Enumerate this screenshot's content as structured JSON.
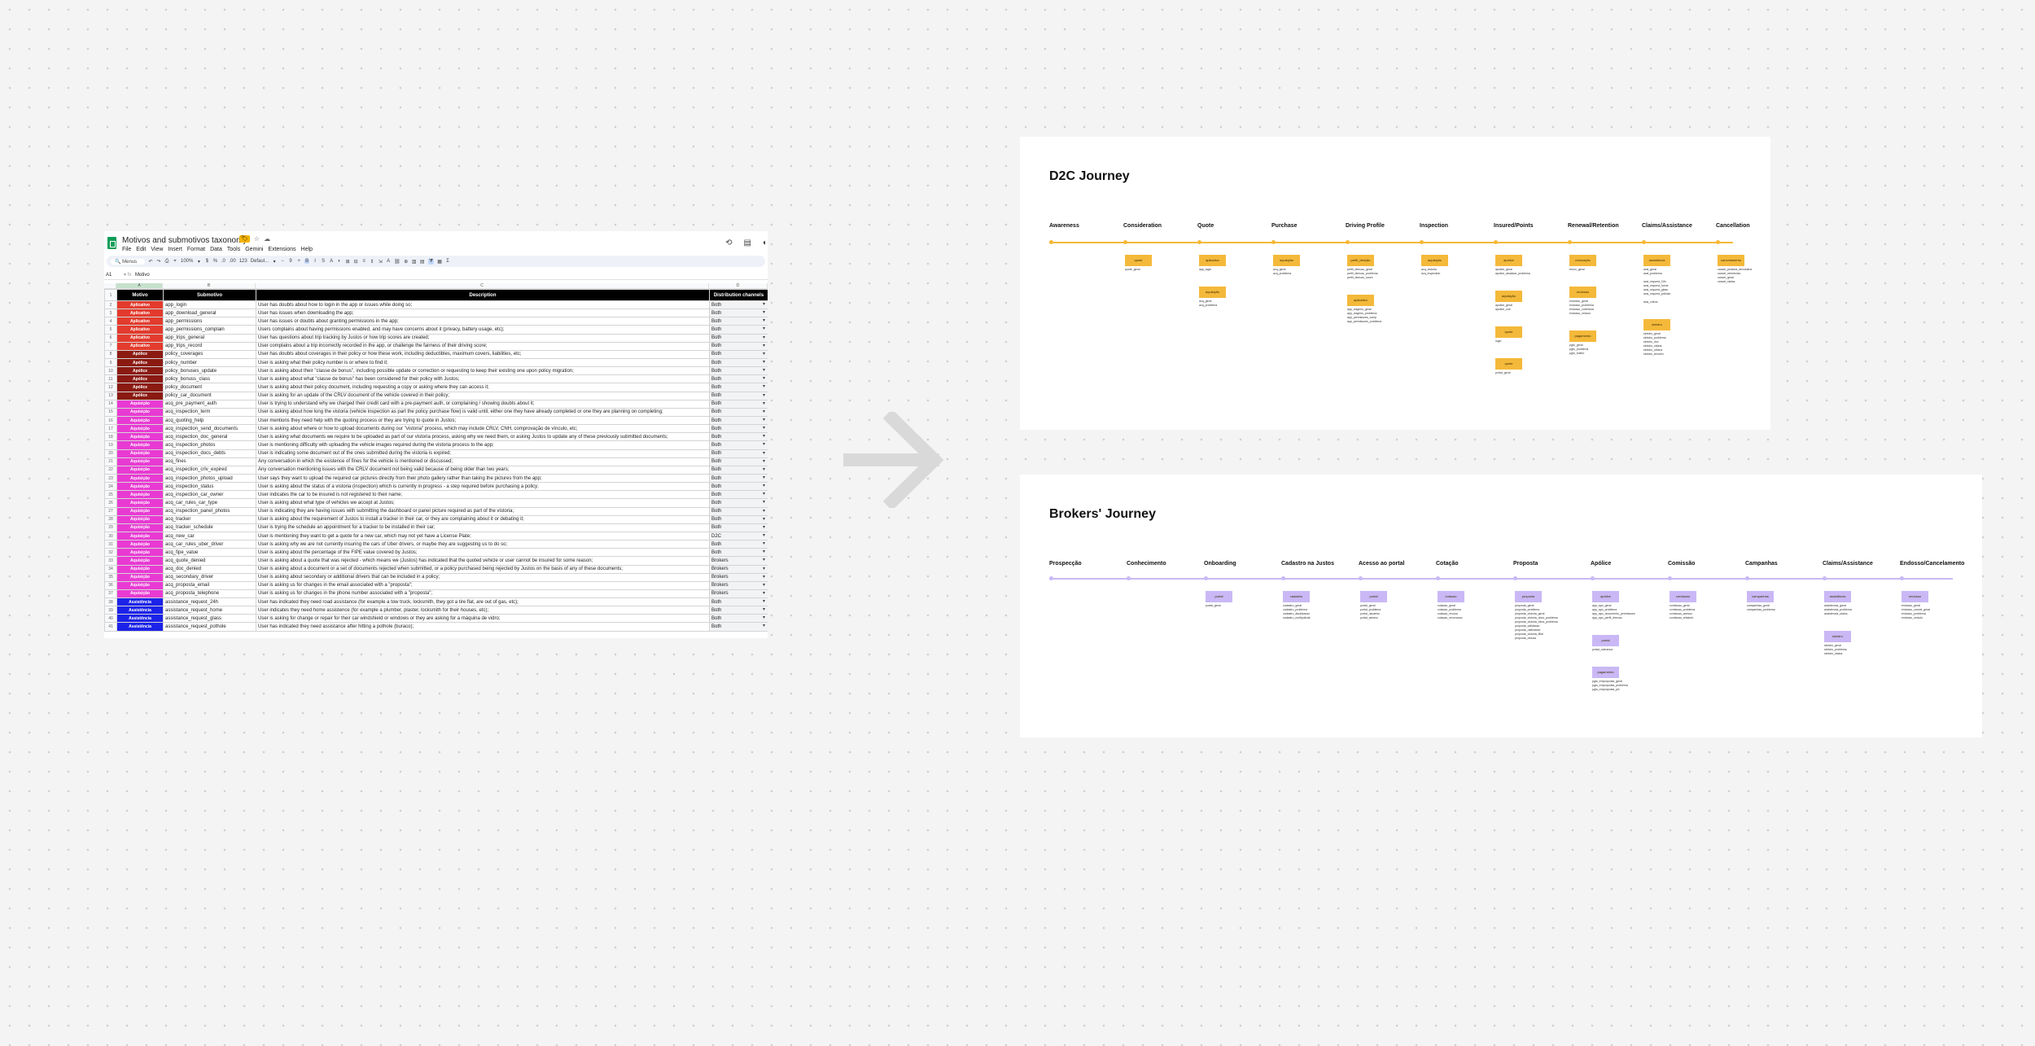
{
  "sheet": {
    "title": "Motivos and submotivos taxonomy",
    "menu": [
      "File",
      "Edit",
      "View",
      "Insert",
      "Format",
      "Data",
      "Tools",
      "Gemini",
      "Extensions",
      "Help"
    ],
    "toolbar": {
      "search": "Menus",
      "items": [
        "↶",
        "↷",
        "⎙",
        "⌖",
        "100%",
        "▾",
        "$",
        "%",
        ".0",
        ".00",
        "123",
        "Defaul...",
        "▾",
        "−",
        "9",
        "+",
        "B",
        "I",
        "S",
        "A",
        "◐",
        "⊞",
        "⊟",
        "≡",
        "⇕",
        "⇲",
        "A",
        "⛓",
        "⊕",
        "▥",
        "▤",
        "⧩",
        "▦",
        "Σ"
      ]
    },
    "cell_ref": "A1",
    "formula": "Motivo",
    "col_letters": [
      "A",
      "B",
      "C",
      "D"
    ],
    "headers": [
      "Motivo",
      "Submotivo",
      "Description",
      "Distribution channels"
    ],
    "rows": [
      [
        "2",
        "Aplicativo",
        "app_login",
        "User has doubts about how to login in the app or issues while doing so;",
        "Both"
      ],
      [
        "3",
        "Aplicativo",
        "app_download_general",
        "User has issues when downloading the app;",
        "Both"
      ],
      [
        "4",
        "Aplicativo",
        "app_permissions",
        "User has issues or doubts about granting permissions in the app;",
        "Both"
      ],
      [
        "5",
        "Aplicativo",
        "app_permissions_complain",
        "Users complains about having permissions enabled, and may have concerns about it (privacy, battery usage, etc);",
        "Both"
      ],
      [
        "6",
        "Aplicativo",
        "app_trips_general",
        "User has questions about trip tracking by Justos or how trip scores are created;",
        "Both"
      ],
      [
        "7",
        "Aplicativo",
        "app_trips_record",
        "User complains about a trip incorrectly recorded in the app, or challenge the fairness of their driving score;",
        "Both"
      ],
      [
        "8",
        "Apólice",
        "policy_coverages",
        "User has doubts about coverages in their policy or how these work, including deductibles, maximum covers, liabilities, etc;",
        "Both"
      ],
      [
        "9",
        "Apólice",
        "policy_number",
        "User is asking what their policy number is or where to find it;",
        "Both"
      ],
      [
        "10",
        "Apólice",
        "policy_bonuses_update",
        "User is asking about their \"classe de bonus\", including possible update or correction or requesting to keep their existing one upon policy migration;",
        "Both"
      ],
      [
        "11",
        "Apólice",
        "policy_bonuss_class",
        "User is asking about what \"classe de bonus\" has been considered for their policy with Justos;",
        "Both"
      ],
      [
        "12",
        "Apólice",
        "policy_document",
        "User is asking about their policy document, including requesting a copy or asking where they can access it;",
        "Both"
      ],
      [
        "13",
        "Apólice",
        "policy_car_document",
        "User is asking for an update of the CRLV document of the vehicle covered in their policy;",
        "Both"
      ],
      [
        "14",
        "Aquisição",
        "acq_pre_payment_auth",
        "User is trying to understand why we charged their credit card with a pre-payment auth, or complaining / showing doubts about it;",
        "Both"
      ],
      [
        "15",
        "Aquisição",
        "acq_inspection_term",
        "User is asking about how long the vistoria (vehicle inspection as part the policy purchase flow) is valid until, either one they have already completed or one they are planning on completing;",
        "Both"
      ],
      [
        "16",
        "Aquisição",
        "acq_quoting_help",
        "User mentions they need help with the quoting process or they are trying to quote in Justos;",
        "Both"
      ],
      [
        "17",
        "Aquisição",
        "acq_inspection_send_documents",
        "User is asking about where or how to upload documents during our \"vistoria\" process, which may include CRLV, CNH, comprovação de vínculo, etc;",
        "Both"
      ],
      [
        "18",
        "Aquisição",
        "acq_inspection_doc_general",
        "User is asking what documents we require to be uploaded as part of our vistoria process, asking why we need them, or asking Justos to update any of these previously submitted documents;",
        "Both"
      ],
      [
        "19",
        "Aquisição",
        "acq_inspection_photos",
        "User is mentioning difficulty with uploading the vehicle images required during the vistoria process to the app;",
        "Both"
      ],
      [
        "20",
        "Aquisição",
        "acq_inspection_docs_debts",
        "User is indicating some document out of the ones submitted during the vistoria is expired;",
        "Both"
      ],
      [
        "21",
        "Aquisição",
        "acq_fines",
        "Any conversation in which the existence of fines for the vehicle is mentioned or discussed;",
        "Both"
      ],
      [
        "22",
        "Aquisição",
        "acq_inspection_crlv_expired",
        "Any conversation mentioning issues with the CRLV document not being valid because of being older than two years;",
        "Both"
      ],
      [
        "23",
        "Aquisição",
        "acq_inspection_photos_upload",
        "User says they want to upload the required car pictures directly from their photo gallery rather than taking the pictures from the app;",
        "Both"
      ],
      [
        "24",
        "Aquisição",
        "acq_inspection_status",
        "User is asking about the status of a vistoria (inspection) which is currently in progress - a step required before purchasing a policy;",
        "Both"
      ],
      [
        "25",
        "Aquisição",
        "acq_inspection_car_owner",
        "User indicates the car to be insured is not registered to their name;",
        "Both"
      ],
      [
        "26",
        "Aquisição",
        "acq_car_rules_car_type",
        "User is asking about what type of vehicles we accept at Justos;",
        "Both"
      ],
      [
        "27",
        "Aquisição",
        "acq_inspection_panel_photos",
        "User is indicating they are having issues with submitting the dashboard or panel picture required as part of the vistoria;",
        "Both"
      ],
      [
        "28",
        "Aquisição",
        "acq_tracker",
        "User is asking about the requirement of Justos to install a tracker in their car, or they are complaining about it or debating it;",
        "Both"
      ],
      [
        "29",
        "Aquisição",
        "acq_tracker_schedule",
        "User is trying the schedule an appointment for a tracker to be installed in their car;",
        "Both"
      ],
      [
        "30",
        "Aquisição",
        "acq_new_car",
        "User is mentioning they want to get a quote for a new car, which may not yet have a License Plate;",
        "D2C"
      ],
      [
        "31",
        "Aquisição",
        "acq_car_rules_uber_driver",
        "User is asking why we are not currently insuring the cars of Uber drivers, or maybe they are suggesting us to do so;",
        "Both"
      ],
      [
        "32",
        "Aquisição",
        "acq_fipe_value",
        "User is asking about the percentage of the FIPE value covered by Justos;",
        "Both"
      ],
      [
        "33",
        "Aquisição",
        "acq_quote_denied",
        "User is asking about a quote that was rejected - which means we (Justos) has indicated that the quoted vehicle or user cannot be insured for some reason;",
        "Brokers"
      ],
      [
        "34",
        "Aquisição",
        "acq_doc_denied",
        "User is asking about a document or a set of documents rejected when submitted, or a policy purchased being rejected by Justos on the basis of any of these documents;",
        "Brokers"
      ],
      [
        "35",
        "Aquisição",
        "acq_secondary_driver",
        "User is asking about secondary or additional drivers that can be included in a policy;",
        "Brokers"
      ],
      [
        "36",
        "Aquisição",
        "acq_proposta_email",
        "User is asking us for changes in the email associated with a \"proposta\";",
        "Brokers"
      ],
      [
        "37",
        "Aquisição",
        "acq_proposta_telephone",
        "User is asking us for changes in the phone number associated with a \"proposta\";",
        "Brokers"
      ],
      [
        "38",
        "Assistência",
        "assistance_request_24h",
        "User has indicated they need road assistance (for example a tow truck, locksmith, they got a tire flat, are out of gas, etc);",
        "Both"
      ],
      [
        "39",
        "Assistência",
        "assistance_request_home",
        "User indicates they need home assistence (for example a plumber, plaster, locksmith for their houses, etc);",
        "Both"
      ],
      [
        "40",
        "Assistência",
        "assistance_request_glass",
        "User is asking for change or repair for their car windshield or windows or they are asking for a máquina de vidro;",
        "Both"
      ],
      [
        "41",
        "Assistência",
        "assistance_request_pothole",
        "User has indicated they need assistance after hitting a pothole (buraco);",
        "Both"
      ]
    ],
    "motivo_colors": {
      "Aplicativo": "#e33b2e",
      "Apólice": "#8b1a12",
      "Aquisição": "#e83ad3",
      "Assistência": "#1c23e8"
    }
  },
  "d2c": {
    "title": "D2C Journey",
    "accent": "#f4b93a",
    "stages": [
      {
        "label": "Awareness",
        "groups": []
      },
      {
        "label": "Consideration",
        "groups": [
          {
            "tag": "quote",
            "items": [
              "quote_geral"
            ]
          }
        ]
      },
      {
        "label": "Quote",
        "groups": [
          {
            "tag": "aplicativo",
            "items": [
              "app_login"
            ]
          },
          {
            "tag": "aquisição",
            "items": [
              "acq_geral",
              "acq_problema"
            ]
          }
        ]
      },
      {
        "label": "Purchase",
        "groups": [
          {
            "tag": "aquisição",
            "items": [
              "acq_geral",
              "acq_problema"
            ]
          }
        ]
      },
      {
        "label": "Driving Profile",
        "groups": [
          {
            "tag": "perfil_direção",
            "items": [
              "perfil_direcao_geral",
              "perfil_direcao_problema",
              "perfil_direcao_score"
            ]
          },
          {
            "tag": "aplicativo",
            "items": [
              "app_viagens_geral",
              "app_viagens_problema",
              "app_permissoes_comp",
              "app_permissoes_problema"
            ]
          }
        ]
      },
      {
        "label": "Inspection",
        "groups": [
          {
            "tag": "aquisição",
            "items": [
              "acq_vistoria",
              "acq_inspection"
            ]
          }
        ]
      },
      {
        "label": "Insured/Points",
        "groups": [
          {
            "tag": "apólice",
            "items": [
              "apolice_geral",
              "apolice_atualizar_problema"
            ]
          },
          {
            "tag": "aquisição",
            "items": [
              "apolice_geral",
              "apolice_cob"
            ]
          },
          {
            "tag": "quote",
            "items": [
              "login"
            ]
          },
          {
            "tag": "quote",
            "items": [
              "portal_geral"
            ]
          }
        ]
      },
      {
        "label": "Renewal/Retention",
        "groups": [
          {
            "tag": "renovação",
            "items": [
              "renov_geral"
            ]
          },
          {
            "tag": "endosso",
            "items": [
              "endosso_geral",
              "endosso_problema",
              "endosso_cobertura",
              "endosso_veiculo"
            ]
          },
          {
            "tag": "pagamento",
            "items": [
              "pgto_geral",
              "pgto_problema",
              "pgto_boleto"
            ]
          }
        ]
      },
      {
        "label": "Claims/Assistance",
        "groups": [
          {
            "tag": "assistência",
            "items": [
              "assi_geral",
              "assi_problema",
              "",
              "assi_request_24h",
              "assi_request_home",
              "assi_request_glass",
              "assi_request_pothole",
              "",
              "assi_vidros"
            ]
          },
          {
            "tag": "sinistro",
            "items": [
              "sinistro_geral",
              "sinistro_problema",
              "sinistro_doc",
              "sinistro_status",
              "sinistro_oficina",
              "sinistro_terceiro"
            ]
          }
        ]
      },
      {
        "label": "Cancellation",
        "groups": [
          {
            "tag": "cancelamento",
            "items": [
              "cancel_pedidos_devolutiva",
              "cancel_reembolso",
              "cancel_geral",
              "cancel_status"
            ]
          }
        ]
      }
    ]
  },
  "brokers": {
    "title": "Brokers' Journey",
    "accent": "#c9b8f5",
    "stages": [
      {
        "label": "Prospecção",
        "groups": []
      },
      {
        "label": "Conhecimento",
        "groups": []
      },
      {
        "label": "Onboarding",
        "groups": [
          {
            "tag": "portal",
            "items": [
              "portal_geral"
            ]
          }
        ]
      },
      {
        "label": "Cadastro na Justos",
        "groups": [
          {
            "tag": "cadastro",
            "items": [
              "cadastro_geral",
              "cadastro_problema",
              "cadastro_atualizacao",
              "cadastro_multipolicial"
            ]
          }
        ]
      },
      {
        "label": "Acesso ao portal",
        "groups": [
          {
            "tag": "portal",
            "items": [
              "portal_geral",
              "portal_problema",
              "portal_usuarios",
              "portal_acesso"
            ]
          }
        ]
      },
      {
        "label": "Cotação",
        "groups": [
          {
            "tag": "cotacao",
            "items": [
              "cotacao_geral",
              "cotacao_problema",
              "cotacao_recusa",
              "cotacao_renovacao"
            ]
          }
        ]
      },
      {
        "label": "Proposta",
        "groups": [
          {
            "tag": "proposta",
            "items": [
              "proposta_geral",
              "proposta_problema",
              "proposta_vistoria_geral",
              "proposta_vistoria_docs_problema",
              "proposta_vistoria_fotos_problema",
              "proposta_validacao",
              "proposta_rastreador",
              "proposta_vistoria_filial",
              "proposta_recusa"
            ]
          }
        ]
      },
      {
        "label": "Apólice",
        "groups": [
          {
            "tag": "apólice",
            "items": [
              "app_apo_geral",
              "app_apo_problema",
              "app_apo_documento_permissoes",
              "app_apo_perfil_direcao"
            ]
          },
          {
            "tag": "portal",
            "items": [
              "portal_cobranca"
            ]
          },
          {
            "tag": "pagamento",
            "items": [
              "pgto_emproposta_geral",
              "pgto_emproposta_problema",
              "pgto_emproposta_pix"
            ]
          }
        ]
      },
      {
        "label": "Comissão",
        "groups": [
          {
            "tag": "comissao",
            "items": [
              "comissao_geral",
              "comissao_problema",
              "comissao_acesso",
              "comissao_relatorio"
            ]
          }
        ]
      },
      {
        "label": "Campanhas",
        "groups": [
          {
            "tag": "campanhas",
            "items": [
              "campanhas_geral",
              "campanhas_problema"
            ]
          }
        ]
      },
      {
        "label": "Claims/Assistance",
        "groups": [
          {
            "tag": "assistência",
            "items": [
              "assistencia_geral",
              "assistencia_problema",
              "assistencia_status"
            ]
          },
          {
            "tag": "sinistro",
            "items": [
              "sinistro_geral",
              "sinistro_problema",
              "sinistro_status"
            ]
          }
        ]
      },
      {
        "label": "Endosso/Cancelamento",
        "groups": [
          {
            "tag": "endosso",
            "items": [
              "endosso_geral",
              "endosso_cancel_geral",
              "endosso_problema",
              "endosso_veiculo"
            ]
          }
        ]
      }
    ]
  }
}
